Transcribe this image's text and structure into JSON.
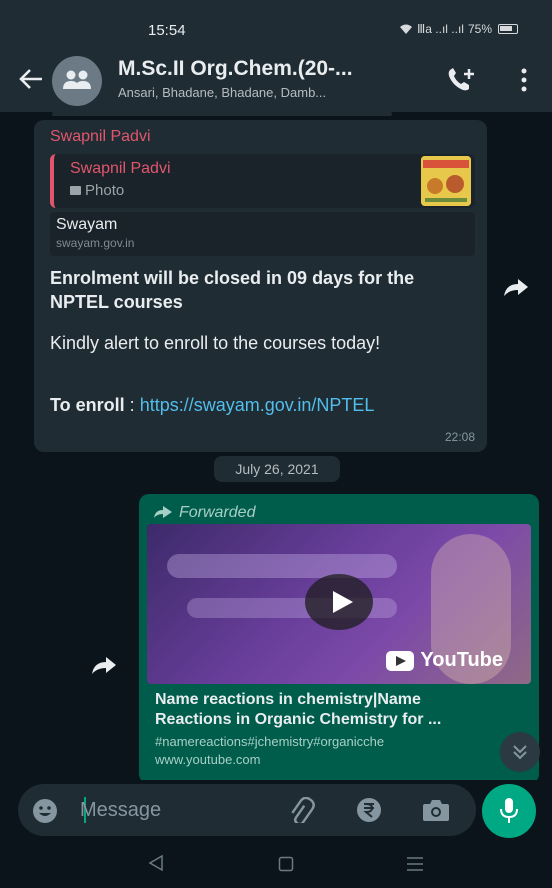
{
  "status_bar": {
    "time": "15:54",
    "battery": "75%",
    "signal_text": "Ⅲa ..ıl ..ıl"
  },
  "header": {
    "title": "M.Sc.II Org.Chem.(20-...",
    "subtitle": "Ansari, Bhadane, Bhadane, Damb..."
  },
  "messages": {
    "incoming": {
      "sender": "Swapnil Padvi",
      "quote_sender": "Swapnil Padvi",
      "quote_type": "Photo",
      "link_title": "Swayam",
      "link_domain": "swayam.gov.in",
      "bold_text": "Enrolment will be closed in 09 days for the NPTEL courses",
      "body_text": "Kindly alert to enroll to the courses today!",
      "enroll_label": "To enroll",
      "enroll_sep": " : ",
      "enroll_link": "https://swayam.gov.in/NPTEL",
      "time": "22:08"
    },
    "date_divider": "July 26, 2021",
    "outgoing": {
      "forwarded_label": "Forwarded",
      "youtube_brand": "YouTube",
      "title_line1": "Name reactions in chemistry|Name",
      "title_line2": "Reactions in Organic Chemistry for ...",
      "tags": "#namereactions#jchemistry#organicche",
      "domain": "www.youtube.com"
    }
  },
  "input": {
    "placeholder": "Message",
    "value": ""
  },
  "colors": {
    "header_bg": "#1f2c33",
    "chat_bg": "#0b141a",
    "incoming_bubble": "#1f2c33",
    "outgoing_bubble": "#005c4b",
    "sender_name": "#e2566d",
    "link": "#53bdeb",
    "accent": "#00a884"
  },
  "icons": [
    "back-arrow-icon",
    "group-avatar-icon",
    "add-call-icon",
    "more-vert-icon",
    "forward-icon",
    "play-icon",
    "youtube-icon",
    "chevrons-down-icon",
    "emoji-icon",
    "attach-icon",
    "rupee-icon",
    "camera-icon",
    "mic-icon",
    "nav-back-icon",
    "nav-home-icon",
    "nav-menu-icon"
  ]
}
